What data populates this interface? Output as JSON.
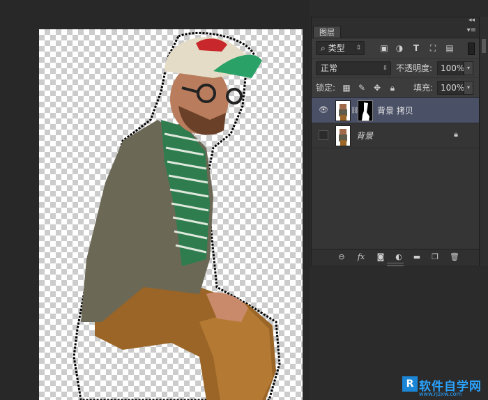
{
  "panel": {
    "tab_label": "图层",
    "collapse_glyph": "◂◂",
    "menu_glyph": "▾≡"
  },
  "filter": {
    "icon": "search-icon",
    "kind_label": "类型"
  },
  "blend": {
    "mode": "正常",
    "opacity_label": "不透明度:",
    "opacity_value": "100%"
  },
  "lock": {
    "label": "锁定:",
    "fill_label": "填充:",
    "fill_value": "100%"
  },
  "layers": [
    {
      "name": "背景 拷贝",
      "selected": true,
      "visible": true,
      "has_mask": true
    },
    {
      "name": "背景",
      "selected": false,
      "visible": false,
      "locked": true
    }
  ],
  "bottom_icons": [
    "link-icon",
    "fx-icon",
    "mask-icon",
    "adjustment-icon",
    "folder-icon",
    "new-layer-icon",
    "trash-icon"
  ],
  "bottom_fx_label": "fx",
  "watermark": {
    "logo": "R",
    "text": "软件自学网",
    "url": "www.rjzxw.com"
  },
  "colors": {
    "selected_layer": "#4a5066",
    "panel_bg": "#3c3c3c",
    "watermark": "#29a3ff"
  }
}
